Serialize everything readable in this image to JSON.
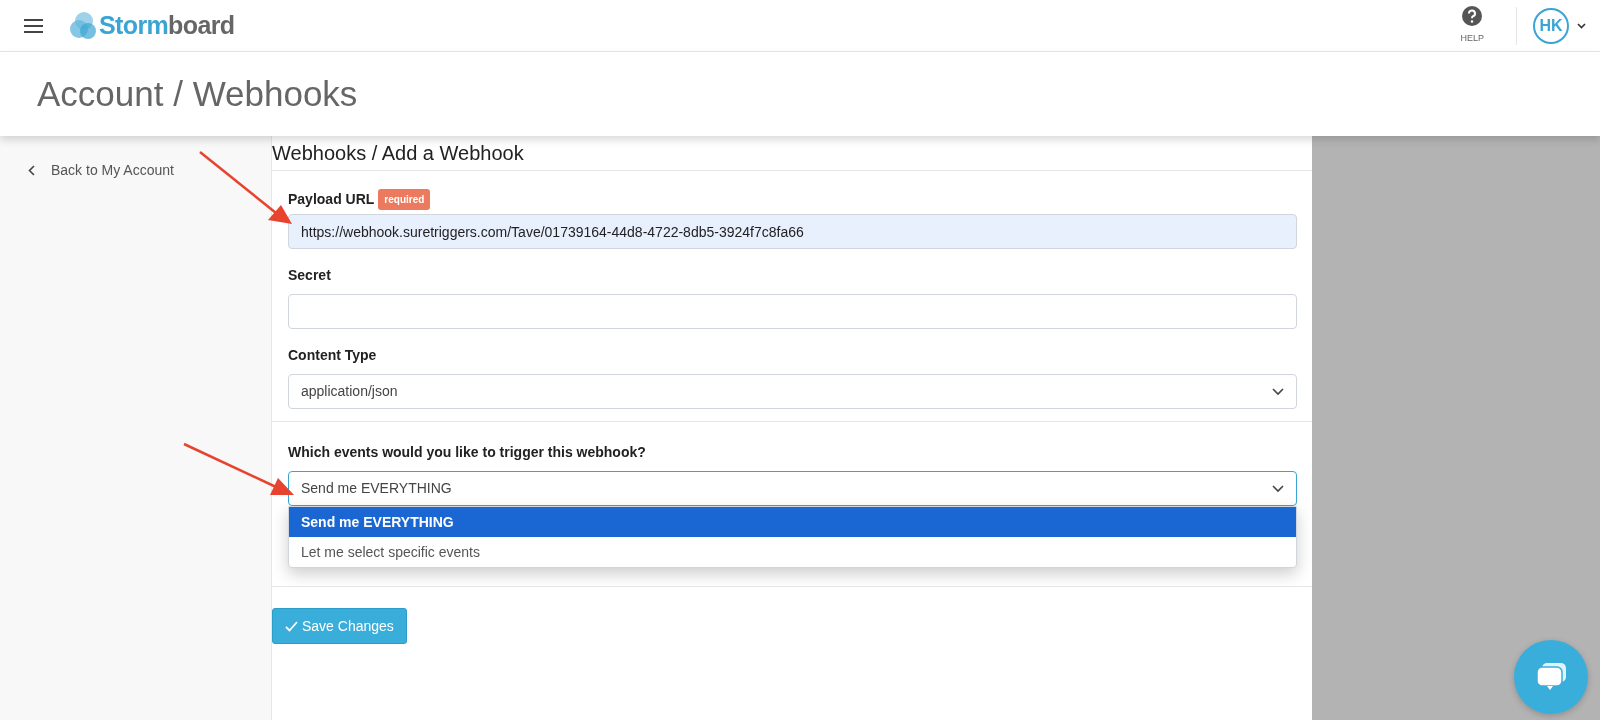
{
  "header": {
    "logo": {
      "part1": "Storm",
      "part2": "board"
    },
    "help": {
      "label": "HELP"
    },
    "user": {
      "initials": "HK"
    }
  },
  "page_title": "Account / Webhooks",
  "sidebar": {
    "back_link": "Back to My Account"
  },
  "form": {
    "title": "Webhooks / Add a Webhook",
    "payload_url": {
      "label": "Payload URL",
      "badge": "required",
      "value": "https://webhook.suretriggers.com/Tave/01739164-44d8-4722-8db5-3924f7c8fa66"
    },
    "secret": {
      "label": "Secret"
    },
    "content_type": {
      "label": "Content Type",
      "value": "application/json"
    },
    "events": {
      "label": "Which events would you like to trigger this webhook?",
      "value": "Send me EVERYTHING",
      "expanded": true,
      "options": [
        {
          "label": "Send me EVERYTHING",
          "selected": true
        },
        {
          "label": "Let me select specific events",
          "selected": false
        }
      ]
    },
    "save_button": "Save Changes"
  }
}
